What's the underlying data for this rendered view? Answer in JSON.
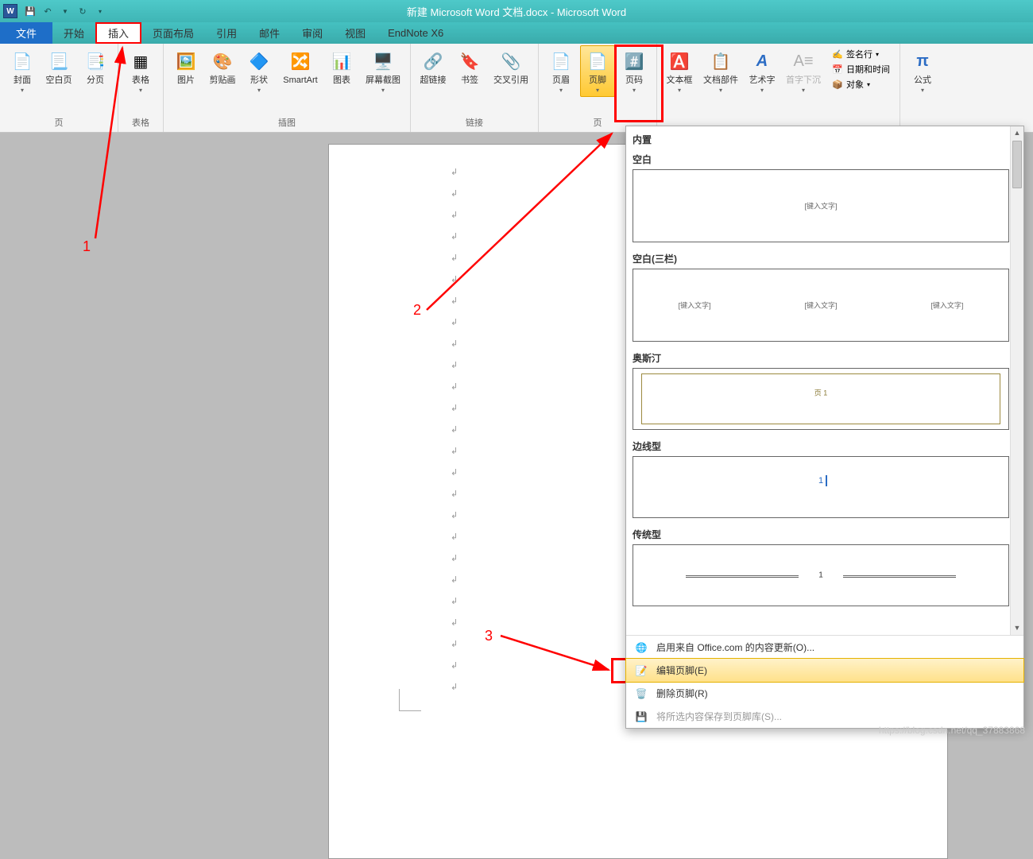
{
  "app": {
    "title": "新建 Microsoft Word 文档.docx - Microsoft Word",
    "word_icon_letter": "W"
  },
  "qat": {
    "save": "💾",
    "undo": "↶",
    "redo": "↻"
  },
  "tabs": {
    "file": "文件",
    "home": "开始",
    "insert": "插入",
    "layout": "页面布局",
    "references": "引用",
    "mailings": "邮件",
    "review": "审阅",
    "view": "视图",
    "endnote": "EndNote X6"
  },
  "ribbon": {
    "groups": {
      "pages": {
        "label": "页",
        "cover": "封面",
        "blank": "空白页",
        "break": "分页"
      },
      "tables": {
        "label": "表格",
        "table": "表格"
      },
      "illustrations": {
        "label": "插图",
        "picture": "图片",
        "clipart": "剪贴画",
        "shapes": "形状",
        "smartart": "SmartArt",
        "chart": "图表",
        "screenshot": "屏幕截图"
      },
      "links": {
        "label": "链接",
        "hyperlink": "超链接",
        "bookmark": "书签",
        "crossref": "交叉引用"
      },
      "headerfooter": {
        "label": "页",
        "header": "页眉",
        "footer": "页脚",
        "pagenum": "页码"
      },
      "text": {
        "label": "",
        "textbox": "文本框",
        "quickparts": "文档部件",
        "wordart": "艺术字",
        "dropcap": "首字下沉",
        "signature": "签名行",
        "datetime": "日期和时间",
        "object": "对象"
      },
      "symbols": {
        "label": "",
        "equation": "公式"
      }
    }
  },
  "gallery": {
    "category": "内置",
    "items": [
      {
        "name": "空白",
        "placeholders": [
          "[键入文字]"
        ]
      },
      {
        "name": "空白(三栏)",
        "placeholders": [
          "[键入文字]",
          "[键入文字]",
          "[键入文字]"
        ]
      },
      {
        "name": "奥斯汀",
        "content": "页 1"
      },
      {
        "name": "边线型",
        "content": "1"
      },
      {
        "name": "传统型",
        "content": "1"
      }
    ],
    "menu": {
      "office": "启用来自 Office.com 的内容更新(O)...",
      "edit": "编辑页脚(E)",
      "remove": "删除页脚(R)",
      "save": "将所选内容保存到页脚库(S)..."
    }
  },
  "annotations": {
    "n1": "1",
    "n2": "2",
    "n3": "3"
  },
  "watermark": "https://blog.csdn.net/qq_37883868"
}
